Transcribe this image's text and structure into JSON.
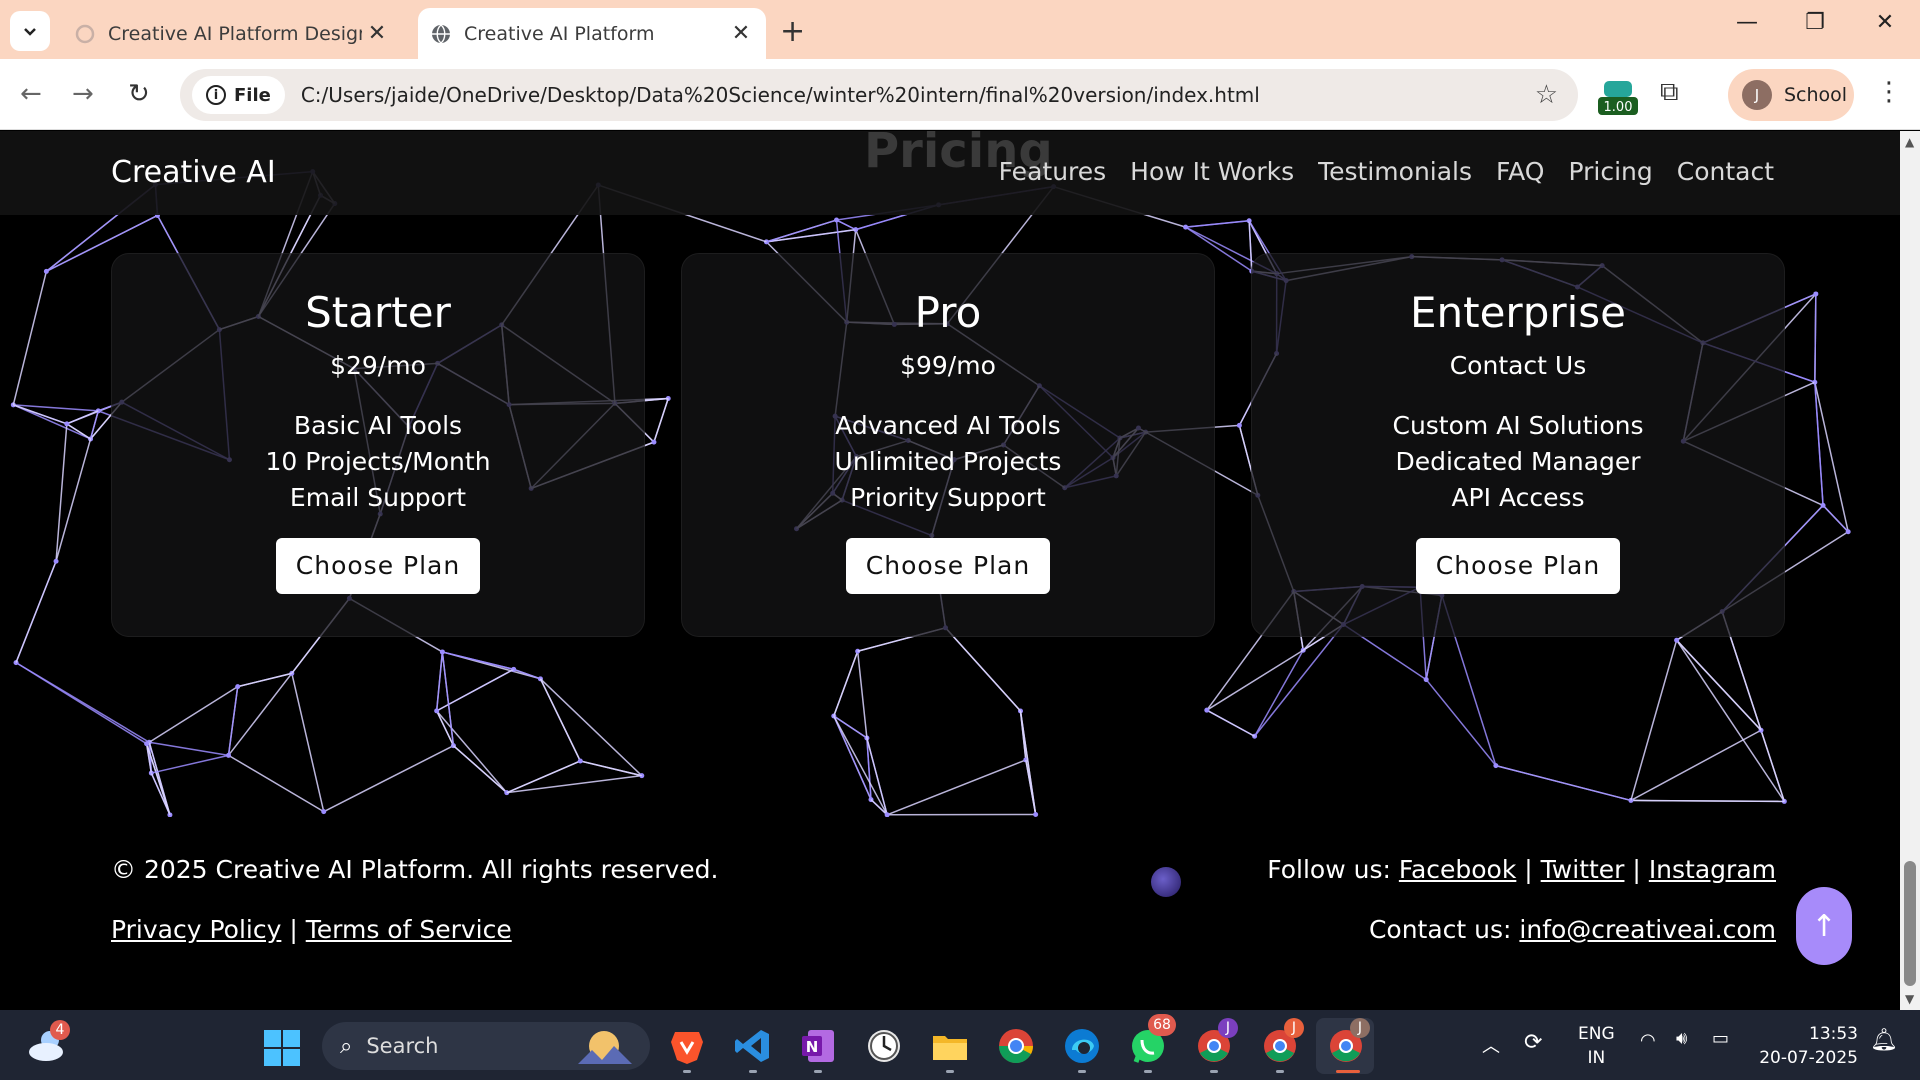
{
  "browser": {
    "tabs": [
      {
        "title": "Creative AI Platform Design - G",
        "active": false
      },
      {
        "title": "Creative AI Platform",
        "active": true
      }
    ],
    "file_chip": "File",
    "url": "C:/Users/jaide/OneDrive/Desktop/Data%20Science/winter%20intern/final%20version/index.html",
    "extension_meter": "1.00",
    "profile_initial": "J",
    "profile_name": "School"
  },
  "site": {
    "brand": "Creative AI",
    "section_heading": "Pricing",
    "nav": [
      "Features",
      "How It Works",
      "Testimonials",
      "FAQ",
      "Pricing",
      "Contact"
    ],
    "plans": [
      {
        "name": "Starter",
        "price": "$29/mo",
        "features": [
          "Basic AI Tools",
          "10 Projects/Month",
          "Email Support"
        ],
        "cta": "Choose Plan"
      },
      {
        "name": "Pro",
        "price": "$99/mo",
        "features": [
          "Advanced AI Tools",
          "Unlimited Projects",
          "Priority Support"
        ],
        "cta": "Choose Plan"
      },
      {
        "name": "Enterprise",
        "price": "Contact Us",
        "features": [
          "Custom AI Solutions",
          "Dedicated Manager",
          "API Access"
        ],
        "cta": "Choose Plan"
      }
    ],
    "footer": {
      "copyright": "© 2025 Creative AI Platform. All rights reserved.",
      "privacy": "Privacy Policy",
      "terms": "Terms of Service",
      "link_sep": "|",
      "follow_prefix": "Follow us:",
      "social": [
        "Facebook",
        "Twitter",
        "Instagram"
      ],
      "contact_prefix": "Contact us:",
      "email": "info@creativeai.com"
    },
    "back_to_top": "↑",
    "accent_color": "#a78bfa",
    "network_line_color": "#9b8cff"
  },
  "taskbar": {
    "weather_badge": "4",
    "search_placeholder": "Search",
    "whatsapp_badge": "68",
    "chrome_badge_1": "J",
    "chrome_badge_2": "J",
    "chrome_badge_3": "J",
    "lang_line1": "ENG",
    "lang_line2": "IN",
    "time": "13:53",
    "date": "20-07-2025"
  }
}
